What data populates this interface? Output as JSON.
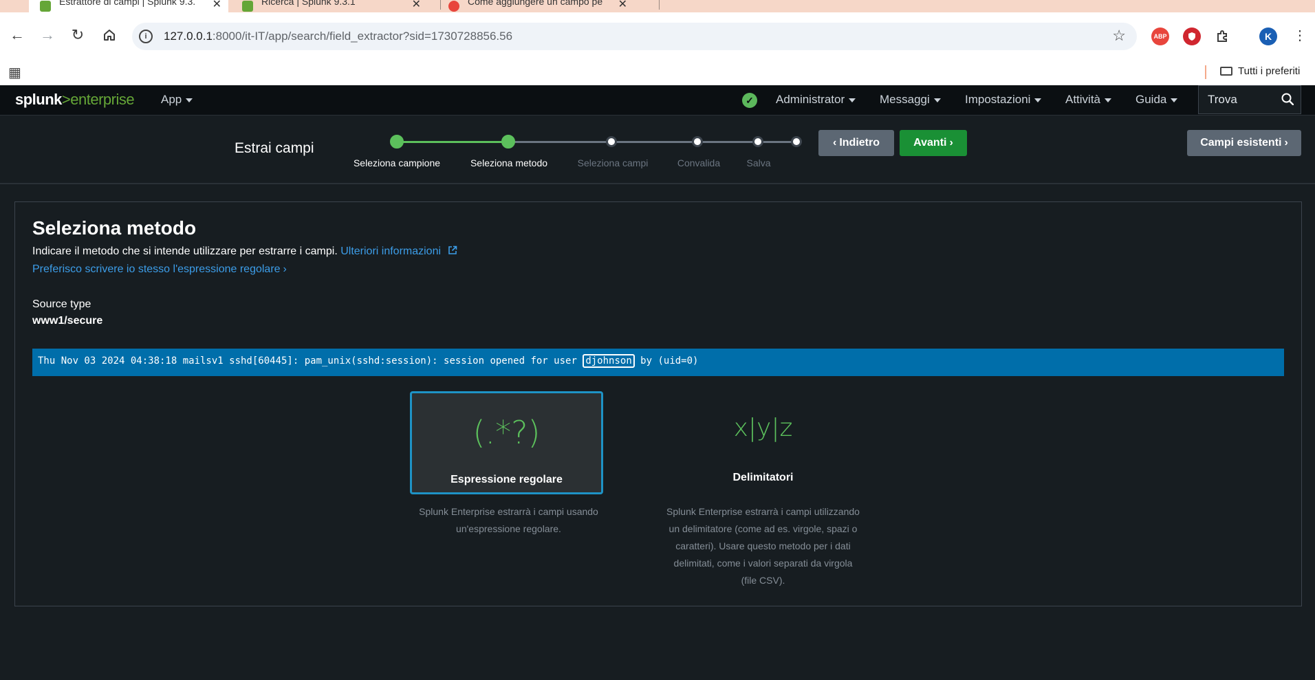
{
  "browser": {
    "tabs": [
      {
        "title": "Estrattore di campi | Splunk 9.3.",
        "active": true
      },
      {
        "title": "Ricerca | Splunk 9.3.1",
        "active": false
      },
      {
        "title": "Come aggiungere un campo pe",
        "active": false
      }
    ],
    "url_host": "127.0.0.1",
    "url_rest": ":8000/it-IT/app/search/field_extractor?sid=1730728856.56",
    "extensions": [
      "ABP",
      "K"
    ],
    "bookmarks_all": "Tutti i preferiti"
  },
  "header": {
    "logo_splunk": "splunk",
    "logo_gt": ">",
    "logo_product": "enterprise",
    "app_menu": "App",
    "menus": [
      "Administrator",
      "Messaggi",
      "Impostazioni",
      "Attività",
      "Guida"
    ],
    "search_placeholder": "Trova"
  },
  "wizard": {
    "title": "Estrai campi",
    "steps": [
      "Seleziona campione",
      "Seleziona metodo",
      "Seleziona campi",
      "Convalida",
      "Salva"
    ],
    "current_step": 2,
    "back_label": "Indietro",
    "next_label": "Avanti",
    "existing_fields_label": "Campi esistenti"
  },
  "main": {
    "heading": "Seleziona metodo",
    "description": "Indicare il metodo che si intende utilizzare per estrarre i campi. ",
    "more_info": "Ulteriori informazioni",
    "regex_link": "Preferisco scrivere io stesso l'espressione regolare",
    "source_type_label": "Source type",
    "source_type_value": "www1/secure",
    "event_before": "Thu Nov 03 2024 04:38:18 mailsv1 sshd[60445]: pam_unix(sshd:session): session opened for user ",
    "event_highlight": "djohnson",
    "event_after": " by (uid=0)",
    "methods": [
      {
        "symbol": "(.*?)",
        "name": "Espressione regolare",
        "desc": "Splunk Enterprise estrarrà i campi usando un'espressione regolare.",
        "selected": true
      },
      {
        "symbol": "x|y|z",
        "name": "Delimitatori",
        "desc": "Splunk Enterprise estrarrà i campi utilizzando un delimitatore (come ad es. virgole, spazi o caratteri). Usare questo metodo per i dati delimitati, come i valori separati da virgola (file CSV).",
        "selected": false
      }
    ]
  },
  "colors": {
    "accent_green": "#5cc05c",
    "link_blue": "#3c9de8",
    "event_blue": "#006eaa",
    "next_button": "#1a9035"
  }
}
